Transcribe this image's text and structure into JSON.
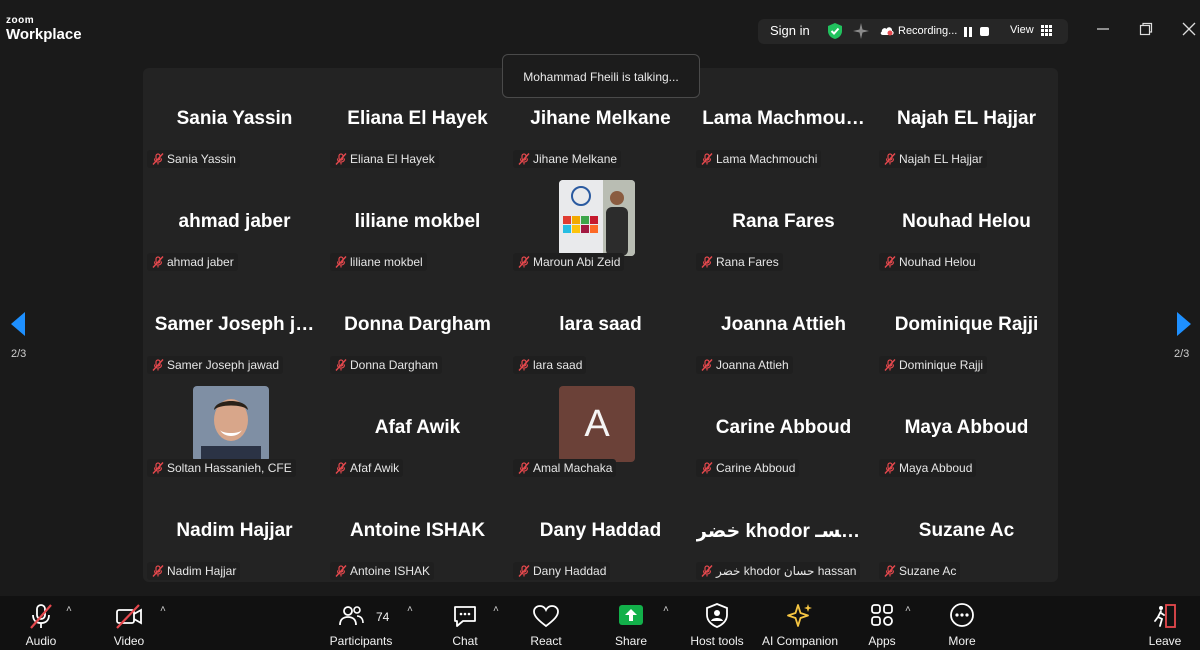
{
  "app": {
    "logo_small": "zoom",
    "logo_main": "Workplace"
  },
  "topbar": {
    "signin": "Sign in",
    "recording": "Recording...",
    "view": "View"
  },
  "toast": "Mohammad Fheili is talking...",
  "pager": {
    "left": "2/3",
    "right": "2/3"
  },
  "participants": [
    {
      "display": "Sania Yassin",
      "tag": "Sania Yassin"
    },
    {
      "display": "Eliana El Hayek",
      "tag": "Eliana El Hayek"
    },
    {
      "display": "Jihane Melkane",
      "tag": "Jihane Melkane"
    },
    {
      "display": "Lama  Machmou…",
      "tag": "Lama Machmouchi"
    },
    {
      "display": "Najah EL Hajjar",
      "tag": "Najah EL Hajjar"
    },
    {
      "display": "ahmad jaber",
      "tag": "ahmad jaber"
    },
    {
      "display": "liliane mokbel",
      "tag": "liliane mokbel"
    },
    {
      "display": "",
      "tag": "Maroun Abi Zeid",
      "avatar": "photo-ribbon"
    },
    {
      "display": "Rana Fares",
      "tag": "Rana Fares"
    },
    {
      "display": "Nouhad Helou",
      "tag": "Nouhad Helou"
    },
    {
      "display": "Samer  Joseph  j…",
      "tag": "Samer Joseph jawad"
    },
    {
      "display": "Donna Dargham",
      "tag": "Donna Dargham"
    },
    {
      "display": "lara saad",
      "tag": "lara saad"
    },
    {
      "display": "Joanna Attieh",
      "tag": "Joanna Attieh"
    },
    {
      "display": "Dominique Rajji",
      "tag": "Dominique Rajji"
    },
    {
      "display": "",
      "tag": "Soltan Hassanieh, CFE",
      "avatar": "photo-portrait"
    },
    {
      "display": "Afaf Awik",
      "tag": "Afaf Awik"
    },
    {
      "display": "",
      "tag": "Amal Machaka",
      "avatar": "letter",
      "letter": "A"
    },
    {
      "display": "Carine Abboud",
      "tag": "Carine Abboud"
    },
    {
      "display": "Maya Abboud",
      "tag": "Maya Abboud"
    },
    {
      "display": "Nadim Hajjar",
      "tag": "Nadim Hajjar"
    },
    {
      "display": "Antoine ISHAK",
      "tag": "Antoine ISHAK"
    },
    {
      "display": "Dany Haddad",
      "tag": "Dany Haddad"
    },
    {
      "display": "خضر khodor حسـ…",
      "tag": "خضر khodor حسان hassan"
    },
    {
      "display": "Suzane Ac",
      "tag": "Suzane Ac"
    }
  ],
  "toolbar": {
    "audio": "Audio",
    "video": "Video",
    "participants": "Participants",
    "participants_count": "74",
    "chat": "Chat",
    "react": "React",
    "share": "Share",
    "host_tools": "Host tools",
    "ai_companion": "AI Companion",
    "apps": "Apps",
    "more": "More",
    "leave": "Leave"
  },
  "colors": {
    "background": "#1a1a1a",
    "stage": "#232323",
    "mute_red": "#e5484d",
    "shield_green": "#21c25e",
    "share_green": "#12b04a",
    "nav_blue": "#1e90ff",
    "ai_yellow": "#f5c542",
    "leave_red": "#e5484d"
  }
}
